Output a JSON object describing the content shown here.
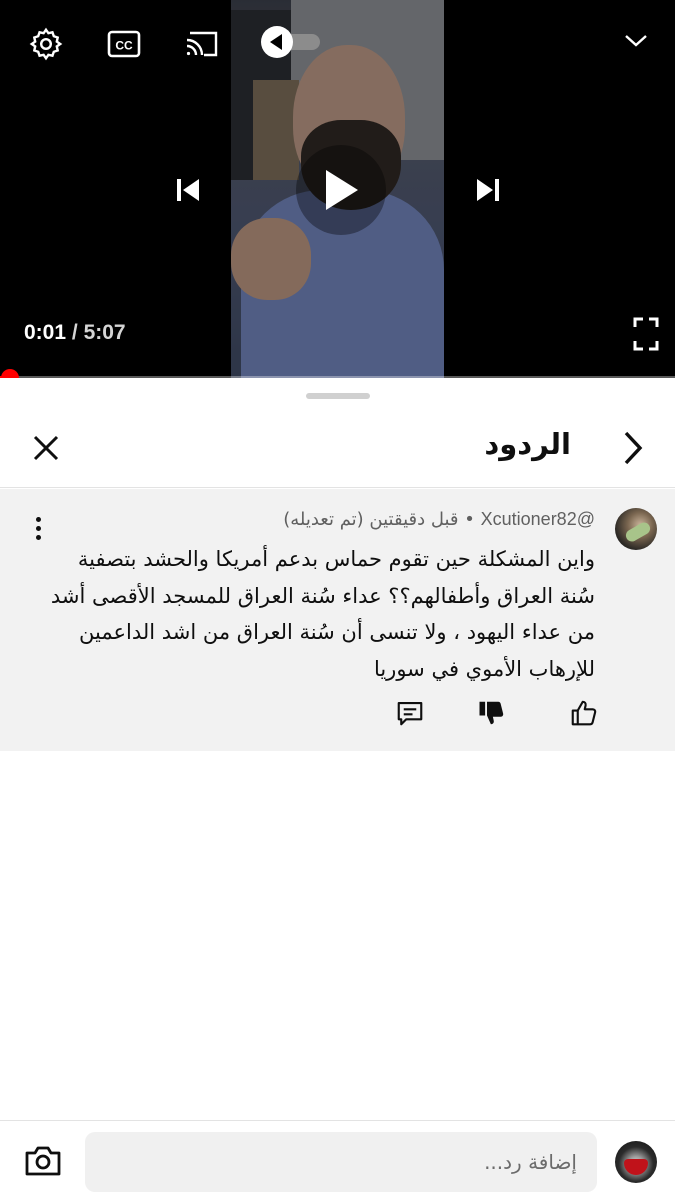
{
  "player": {
    "current_time": "0:01",
    "separator": "/",
    "total_time": "5:07",
    "progress_fraction": 0.003,
    "progress_color": "#ff0000",
    "icons": [
      "settings-icon",
      "cc-icon",
      "cast-icon",
      "autoplay-toggle",
      "chevron-down-icon",
      "skip-previous-icon",
      "play-icon",
      "skip-next-icon",
      "fullscreen-icon"
    ]
  },
  "replies_panel": {
    "title": "الردود",
    "icons": [
      "chevron-right-icon",
      "close-icon"
    ]
  },
  "comment": {
    "author": "@Xcutioner82",
    "dot": "•",
    "time": "قبل دقيقتين (تم تعديله)",
    "lines": [
      "واين المشكلة حين تقوم حماس بدعم أمريكا والحشد بتصفية",
      "سُنة العراق وأطفالهم؟؟ عداء سُنة العراق للمسجد الأقصى أشد",
      "من عداء اليهود ، ولا تنسى أن سُنة العراق من اشد الداعمين",
      "للإرهاب الأموي في سوريا"
    ],
    "actions": [
      "like-icon",
      "dislike-icon",
      "reply-icon",
      "more-vert-icon"
    ]
  },
  "composer": {
    "placeholder": "إضافة رد...",
    "value": ""
  }
}
